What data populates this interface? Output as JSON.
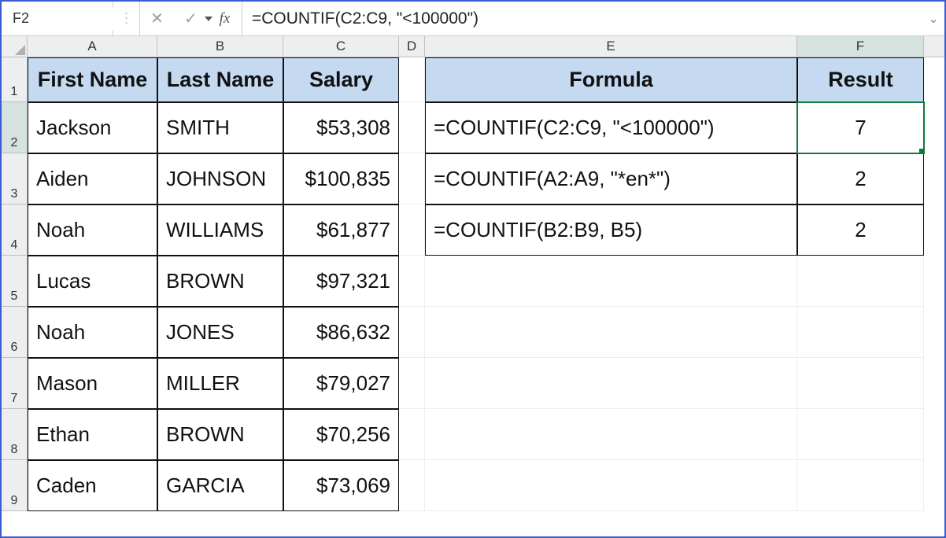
{
  "namebox": {
    "value": "F2"
  },
  "formula_bar": {
    "value": "=COUNTIF(C2:C9, \"<100000\")"
  },
  "icons": {
    "dots": "⋮",
    "cancel": "✕",
    "enter": "✓",
    "fx": "fx",
    "expand": "⌄"
  },
  "col_headers": [
    "A",
    "B",
    "C",
    "D",
    "E",
    "F"
  ],
  "row_headers": [
    "1",
    "2",
    "3",
    "4",
    "5",
    "6",
    "7",
    "8",
    "9"
  ],
  "headers": {
    "A": "First Name",
    "B": "Last Name",
    "C": "Salary",
    "E": "Formula",
    "F": "Result"
  },
  "data": [
    {
      "first": "Jackson",
      "last": "SMITH",
      "salary": "$53,308"
    },
    {
      "first": "Aiden",
      "last": "JOHNSON",
      "salary": "$100,835"
    },
    {
      "first": "Noah",
      "last": "WILLIAMS",
      "salary": "$61,877"
    },
    {
      "first": "Lucas",
      "last": "BROWN",
      "salary": "$97,321"
    },
    {
      "first": "Noah",
      "last": "JONES",
      "salary": "$86,632"
    },
    {
      "first": "Mason",
      "last": "MILLER",
      "salary": "$79,027"
    },
    {
      "first": "Ethan",
      "last": "BROWN",
      "salary": "$70,256"
    },
    {
      "first": "Caden",
      "last": "GARCIA",
      "salary": "$73,069"
    }
  ],
  "formulas": [
    {
      "text": "=COUNTIF(C2:C9, \"<100000\")",
      "result": "7"
    },
    {
      "text": "=COUNTIF(A2:A9, \"*en*\")",
      "result": "2"
    },
    {
      "text": "=COUNTIF(B2:B9, B5)",
      "result": "2"
    }
  ],
  "active_cell": "F2"
}
